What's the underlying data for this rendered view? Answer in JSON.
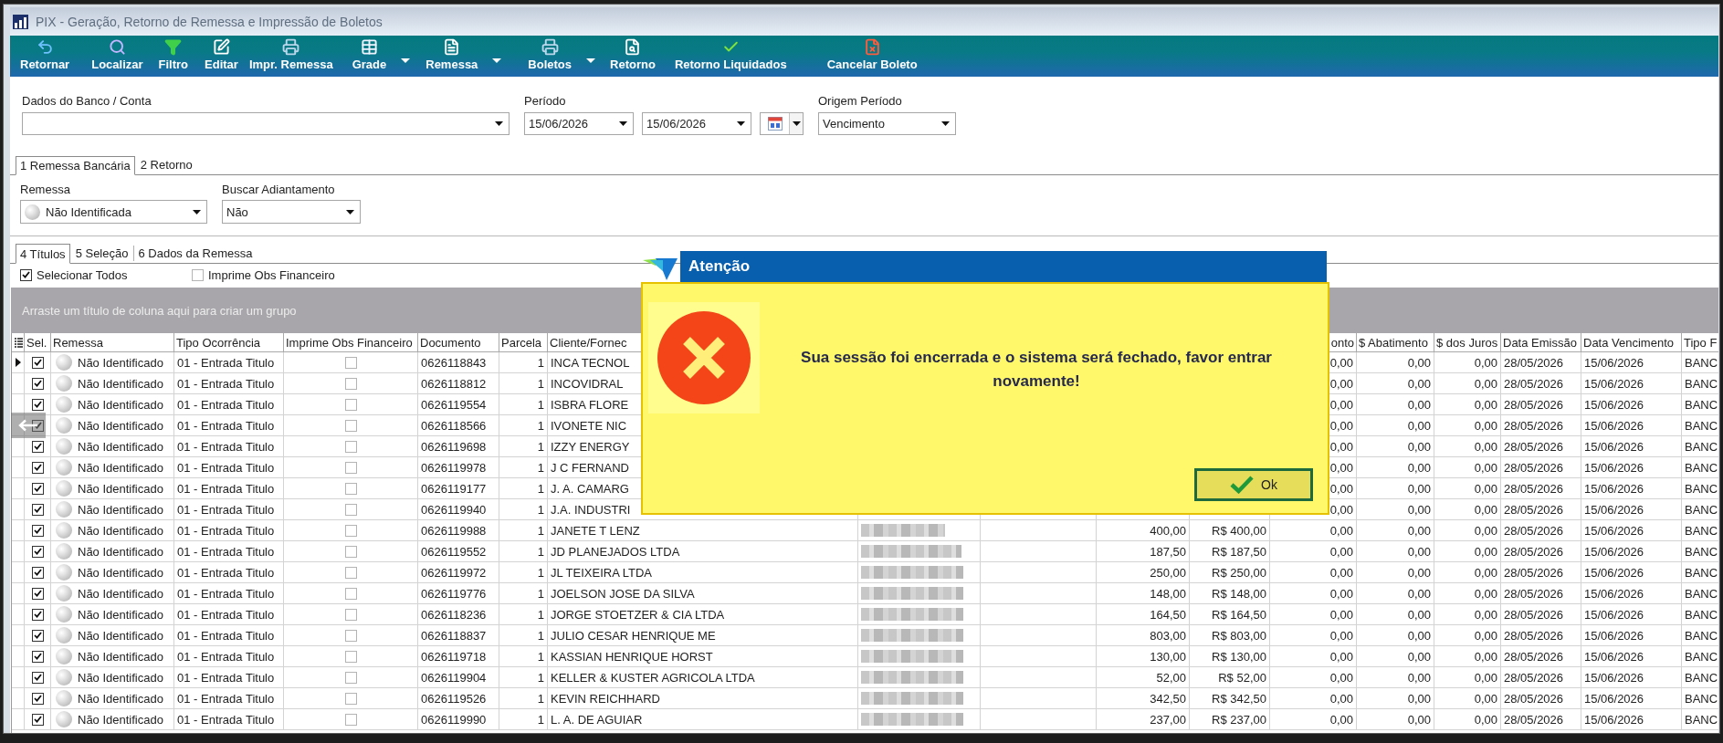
{
  "window": {
    "title": "PIX - Geração, Retorno de Remessa e Impressão de Boletos"
  },
  "toolbar": [
    {
      "label": "Retornar",
      "dropdown": false
    },
    {
      "label": "Localizar",
      "dropdown": false
    },
    {
      "label": "Filtro",
      "dropdown": false
    },
    {
      "label": "Editar",
      "dropdown": false
    },
    {
      "label": "Impr. Remessa",
      "dropdown": false
    },
    {
      "label": "Grade",
      "dropdown": true
    },
    {
      "label": "Remessa",
      "dropdown": true
    },
    {
      "label": "Boletos",
      "dropdown": true
    },
    {
      "label": "Retorno",
      "dropdown": false
    },
    {
      "label": "Retorno Liquidados",
      "dropdown": false
    },
    {
      "label": "Cancelar Boleto",
      "dropdown": false
    }
  ],
  "filters": {
    "bank_account": {
      "label": "Dados do Banco / Conta"
    },
    "period": {
      "label": "Período",
      "start": "15/06/2026",
      "end": "15/06/2026"
    },
    "period_origin": {
      "label": "Origem Período",
      "value": "Vencimento"
    }
  },
  "main_tabs": [
    {
      "label": "1 Remessa Bancária",
      "selected": true
    },
    {
      "label": "2 Retorno",
      "selected": false
    }
  ],
  "remessa_filters": {
    "remessa": {
      "label": "Remessa",
      "value": "Não Identificada"
    },
    "buscar_adiantamento": {
      "label": "Buscar Adiantamento",
      "value": "Não"
    }
  },
  "sub_tabs": [
    {
      "label": "4 Títulos",
      "selected": true
    },
    {
      "label": "5 Seleção",
      "selected": false
    },
    {
      "label": "6 Dados da Remessa",
      "selected": false
    }
  ],
  "options": [
    {
      "label": "Selecionar Todos",
      "checked": true
    },
    {
      "label": "Imprime Obs Financeiro",
      "checked": false
    }
  ],
  "group_panel": {
    "hint": "Arraste um título de coluna aqui para criar um grupo"
  },
  "grid": {
    "columns": {
      "sel": "Sel.",
      "remessa": "Remessa",
      "tipo_ocorrencia": "Tipo Ocorrência",
      "imprime_obs_financeiro": "Imprime Obs Financeiro",
      "documento": "Documento",
      "parcela": "Parcela",
      "cliente_fornec": "Cliente/Fornec",
      "column_12": "onto",
      "abatimento": "$ Abatimento",
      "juros": "$ dos Juros",
      "data_emissao": "Data Emissão",
      "data_vencimento": "Data Vencimento",
      "column_17": "Tipo F"
    },
    "rows": [
      {
        "current": true,
        "sel": true,
        "remessa": "Não Identificado",
        "tipo_ocorrencia": "01 - Entrada Titulo",
        "imprime_obs_financeiro": false,
        "documento": "0626118843",
        "parcela": "1",
        "cliente_fornec": "INCA TECNOL",
        "redacted": false,
        "column_12": "0,00",
        "abatimento": "0,00",
        "juros": "0,00",
        "data_emissao": "28/05/2026",
        "data_vencimento": "15/06/2026",
        "column_17": "BANC"
      },
      {
        "current": false,
        "sel": true,
        "remessa": "Não Identificado",
        "tipo_ocorrencia": "01 - Entrada Titulo",
        "imprime_obs_financeiro": false,
        "documento": "0626118812",
        "parcela": "1",
        "cliente_fornec": "INCOVIDRAL",
        "redacted": false,
        "column_12": "0,00",
        "abatimento": "0,00",
        "juros": "0,00",
        "data_emissao": "28/05/2026",
        "data_vencimento": "15/06/2026",
        "column_17": "BANC"
      },
      {
        "current": false,
        "sel": true,
        "remessa": "Não Identificado",
        "tipo_ocorrencia": "01 - Entrada Titulo",
        "imprime_obs_financeiro": false,
        "documento": "0626119554",
        "parcela": "1",
        "cliente_fornec": "ISBRA FLORE",
        "redacted": false,
        "column_12": "0,00",
        "abatimento": "0,00",
        "juros": "0,00",
        "data_emissao": "28/05/2026",
        "data_vencimento": "15/06/2026",
        "column_17": "BANC"
      },
      {
        "current": false,
        "sel": true,
        "remessa": "Não Identificado",
        "tipo_ocorrencia": "01 - Entrada Titulo",
        "imprime_obs_financeiro": false,
        "documento": "0626118566",
        "parcela": "1",
        "cliente_fornec": "IVONETE NIC",
        "redacted": false,
        "column_12": "0,00",
        "abatimento": "0,00",
        "juros": "0,00",
        "data_emissao": "28/05/2026",
        "data_vencimento": "15/06/2026",
        "column_17": "BANC"
      },
      {
        "current": false,
        "sel": true,
        "remessa": "Não Identificado",
        "tipo_ocorrencia": "01 - Entrada Titulo",
        "imprime_obs_financeiro": false,
        "documento": "0626119698",
        "parcela": "1",
        "cliente_fornec": "IZZY ENERGY",
        "redacted": false,
        "column_12": "0,00",
        "abatimento": "0,00",
        "juros": "0,00",
        "data_emissao": "28/05/2026",
        "data_vencimento": "15/06/2026",
        "column_17": "BANC"
      },
      {
        "current": false,
        "sel": true,
        "remessa": "Não Identificado",
        "tipo_ocorrencia": "01 - Entrada Titulo",
        "imprime_obs_financeiro": false,
        "documento": "0626119978",
        "parcela": "1",
        "cliente_fornec": "J C FERNAND",
        "redacted": false,
        "column_12": "0,00",
        "abatimento": "0,00",
        "juros": "0,00",
        "data_emissao": "28/05/2026",
        "data_vencimento": "15/06/2026",
        "column_17": "BANC"
      },
      {
        "current": false,
        "sel": true,
        "remessa": "Não Identificado",
        "tipo_ocorrencia": "01 - Entrada Titulo",
        "imprime_obs_financeiro": false,
        "documento": "0626119177",
        "parcela": "1",
        "cliente_fornec": "J. A. CAMARG",
        "redacted": false,
        "column_12": "0,00",
        "abatimento": "0,00",
        "juros": "0,00",
        "data_emissao": "28/05/2026",
        "data_vencimento": "15/06/2026",
        "column_17": "BANC"
      },
      {
        "current": false,
        "sel": true,
        "remessa": "Não Identificado",
        "tipo_ocorrencia": "01 - Entrada Titulo",
        "imprime_obs_financeiro": false,
        "documento": "0626119940",
        "parcela": "1",
        "cliente_fornec": "J.A. INDUSTRI",
        "redacted": false,
        "column_12": "0,00",
        "abatimento": "0,00",
        "juros": "0,00",
        "data_emissao": "28/05/2026",
        "data_vencimento": "15/06/2026",
        "column_17": "BANC"
      },
      {
        "current": false,
        "sel": true,
        "remessa": "Não Identificado",
        "tipo_ocorrencia": "01 - Entrada Titulo",
        "imprime_obs_financeiro": false,
        "documento": "0626119988",
        "parcela": "1",
        "cliente_fornec": "JANETE T LENZ",
        "redacted": true,
        "column_10": "400,00",
        "column_11": "R$ 400,00",
        "column_12": "0,00",
        "abatimento": "0,00",
        "juros": "0,00",
        "data_emissao": "28/05/2026",
        "data_vencimento": "15/06/2026",
        "column_17": "BANC"
      },
      {
        "current": false,
        "sel": true,
        "remessa": "Não Identificado",
        "tipo_ocorrencia": "01 - Entrada Titulo",
        "imprime_obs_financeiro": false,
        "documento": "0626119552",
        "parcela": "1",
        "cliente_fornec": "JD PLANEJADOS LTDA",
        "redacted": true,
        "column_10": "187,50",
        "column_11": "R$ 187,50",
        "column_12": "0,00",
        "abatimento": "0,00",
        "juros": "0,00",
        "data_emissao": "28/05/2026",
        "data_vencimento": "15/06/2026",
        "column_17": "BANC"
      },
      {
        "current": false,
        "sel": true,
        "remessa": "Não Identificado",
        "tipo_ocorrencia": "01 - Entrada Titulo",
        "imprime_obs_financeiro": false,
        "documento": "0626119972",
        "parcela": "1",
        "cliente_fornec": "JL TEIXEIRA LTDA",
        "redacted": true,
        "column_10": "250,00",
        "column_11": "R$ 250,00",
        "column_12": "0,00",
        "abatimento": "0,00",
        "juros": "0,00",
        "data_emissao": "28/05/2026",
        "data_vencimento": "15/06/2026",
        "column_17": "BANC"
      },
      {
        "current": false,
        "sel": true,
        "remessa": "Não Identificado",
        "tipo_ocorrencia": "01 - Entrada Titulo",
        "imprime_obs_financeiro": false,
        "documento": "0626119776",
        "parcela": "1",
        "cliente_fornec": "JOELSON JOSE DA SILVA",
        "redacted": true,
        "column_10": "148,00",
        "column_11": "R$ 148,00",
        "column_12": "0,00",
        "abatimento": "0,00",
        "juros": "0,00",
        "data_emissao": "28/05/2026",
        "data_vencimento": "15/06/2026",
        "column_17": "BANC"
      },
      {
        "current": false,
        "sel": true,
        "remessa": "Não Identificado",
        "tipo_ocorrencia": "01 - Entrada Titulo",
        "imprime_obs_financeiro": false,
        "documento": "0626118236",
        "parcela": "1",
        "cliente_fornec": "JORGE STOETZER & CIA LTDA",
        "redacted": true,
        "column_10": "164,50",
        "column_11": "R$ 164,50",
        "column_12": "0,00",
        "abatimento": "0,00",
        "juros": "0,00",
        "data_emissao": "28/05/2026",
        "data_vencimento": "15/06/2026",
        "column_17": "BANC"
      },
      {
        "current": false,
        "sel": true,
        "remessa": "Não Identificado",
        "tipo_ocorrencia": "01 - Entrada Titulo",
        "imprime_obs_financeiro": false,
        "documento": "0626118837",
        "parcela": "1",
        "cliente_fornec": "JULIO CESAR HENRIQUE ME",
        "redacted": true,
        "column_10": "803,00",
        "column_11": "R$ 803,00",
        "column_12": "0,00",
        "abatimento": "0,00",
        "juros": "0,00",
        "data_emissao": "28/05/2026",
        "data_vencimento": "15/06/2026",
        "column_17": "BANC"
      },
      {
        "current": false,
        "sel": true,
        "remessa": "Não Identificado",
        "tipo_ocorrencia": "01 - Entrada Titulo",
        "imprime_obs_financeiro": false,
        "documento": "0626119718",
        "parcela": "1",
        "cliente_fornec": "KASSIAN HENRIQUE HORST",
        "redacted": true,
        "column_10": "130,00",
        "column_11": "R$ 130,00",
        "column_12": "0,00",
        "abatimento": "0,00",
        "juros": "0,00",
        "data_emissao": "28/05/2026",
        "data_vencimento": "15/06/2026",
        "column_17": "BANC"
      },
      {
        "current": false,
        "sel": true,
        "remessa": "Não Identificado",
        "tipo_ocorrencia": "01 - Entrada Titulo",
        "imprime_obs_financeiro": false,
        "documento": "0626119904",
        "parcela": "1",
        "cliente_fornec": "KELLER & KUSTER AGRICOLA LTDA",
        "redacted": true,
        "column_10": "52,00",
        "column_11": "R$ 52,00",
        "column_12": "0,00",
        "abatimento": "0,00",
        "juros": "0,00",
        "data_emissao": "28/05/2026",
        "data_vencimento": "15/06/2026",
        "column_17": "BANC"
      },
      {
        "current": false,
        "sel": true,
        "remessa": "Não Identificado",
        "tipo_ocorrencia": "01 - Entrada Titulo",
        "imprime_obs_financeiro": false,
        "documento": "0626119526",
        "parcela": "1",
        "cliente_fornec": "KEVIN REICHHARD",
        "redacted": true,
        "column_10": "342,50",
        "column_11": "R$ 342,50",
        "column_12": "0,00",
        "abatimento": "0,00",
        "juros": "0,00",
        "data_emissao": "28/05/2026",
        "data_vencimento": "15/06/2026",
        "column_17": "BANC"
      },
      {
        "current": false,
        "sel": true,
        "remessa": "Não Identificado",
        "tipo_ocorrencia": "01 - Entrada Titulo",
        "imprime_obs_financeiro": false,
        "documento": "0626119990",
        "parcela": "1",
        "cliente_fornec": "L. A. DE AGUIAR",
        "redacted": true,
        "column_10": "237,00",
        "column_11": "R$ 237,00",
        "column_12": "0,00",
        "abatimento": "0,00",
        "juros": "0,00",
        "data_emissao": "28/05/2026",
        "data_vencimento": "15/06/2026",
        "column_17": "BANC"
      }
    ]
  },
  "dialog": {
    "title": "Atenção",
    "message": "Sua sessão foi encerrada e o sistema será fechado, favor entrar novamente!",
    "button": "Ok"
  }
}
